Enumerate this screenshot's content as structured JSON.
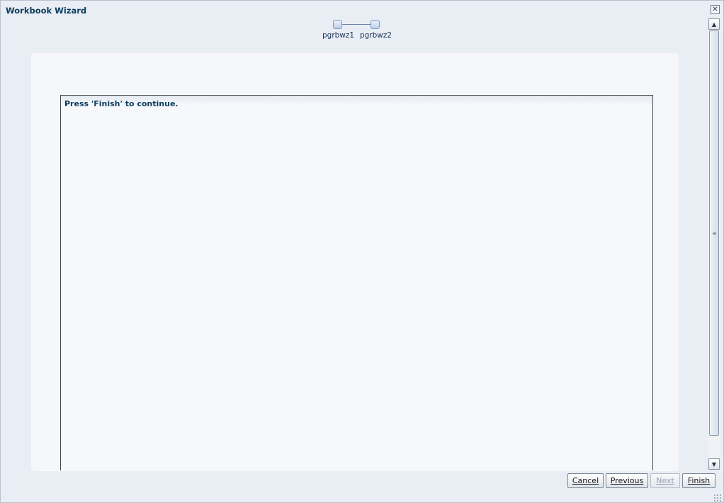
{
  "window": {
    "title": "Workbook Wizard",
    "close_icon": "close-icon"
  },
  "train": {
    "stops": [
      {
        "label": "pgrbwz1"
      },
      {
        "label": "pgrbwz2"
      }
    ]
  },
  "content": {
    "message": "Press 'Finish' to continue."
  },
  "footer": {
    "cancel_label": "Cancel",
    "previous_label": "Previous",
    "next_label": "Next",
    "finish_label": "Finish"
  },
  "colors": {
    "title": "#0b3d5e",
    "background": "#e9edf4",
    "panel": "#f5f7fb"
  }
}
